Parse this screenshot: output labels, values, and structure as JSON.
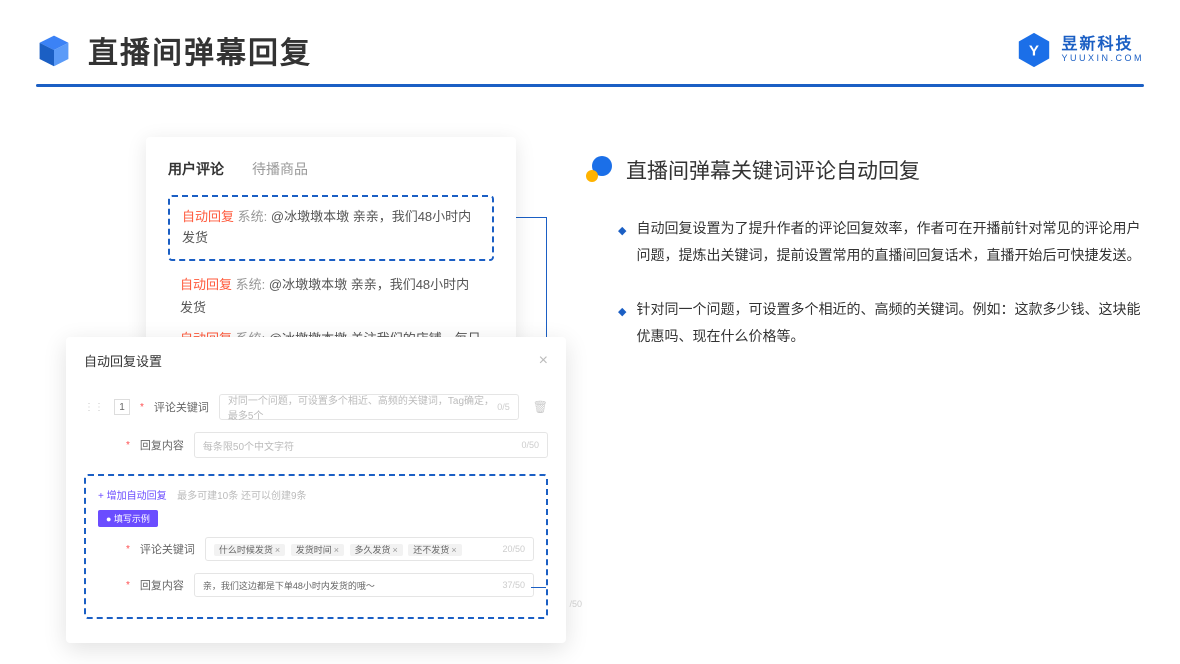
{
  "header": {
    "title": "直播间弹幕回复",
    "brand_cn": "昱新科技",
    "brand_en": "YUUXIN.COM"
  },
  "comments": {
    "tab_active": "用户评论",
    "tab_inactive": "待播商品",
    "highlighted": {
      "tag": "自动回复",
      "sys": "系统:",
      "msg": "@冰墩墩本墩 亲亲，我们48小时内发货"
    },
    "rows": [
      {
        "tag": "自动回复",
        "sys": "系统:",
        "msg": "@冰墩墩本墩 亲亲，我们48小时内发货"
      },
      {
        "tag": "自动回复",
        "sys": "系统:",
        "msg": "@冰墩墩本墩 关注我们的店铺，每日都有热门推荐呦～"
      }
    ]
  },
  "settings": {
    "title": "自动回复设置",
    "num": "1",
    "field1_label": "评论关键词",
    "field1_placeholder": "对同一个问题，可设置多个相近、高频的关键词，Tag确定，最多5个",
    "field1_counter": "0/5",
    "field2_label": "回复内容",
    "field2_placeholder": "每条限50个中文字符",
    "field2_counter": "0/50",
    "add_link": "+ 增加自动回复",
    "add_hint": "最多可建10条 还可以创建9条",
    "example_badge": "● 填写示例",
    "ex_field1_label": "评论关键词",
    "ex_tags": [
      "什么时候发货",
      "发货时间",
      "多久发货",
      "还不发货"
    ],
    "ex_field1_counter": "20/50",
    "ex_field2_label": "回复内容",
    "ex_field2_value": "亲，我们这边都是下单48小时内发货的哦～",
    "ex_field2_counter": "37/50",
    "outside_counter": "/50"
  },
  "feature": {
    "title": "直播间弹幕关键词评论自动回复",
    "bullets": [
      "自动回复设置为了提升作者的评论回复效率，作者可在开播前针对常见的评论用户问题，提炼出关键词，提前设置常用的直播间回复话术，直播开始后可快捷发送。",
      "针对同一个问题，可设置多个相近的、高频的关键词。例如：这款多少钱、这块能优惠吗、现在什么价格等。"
    ]
  }
}
